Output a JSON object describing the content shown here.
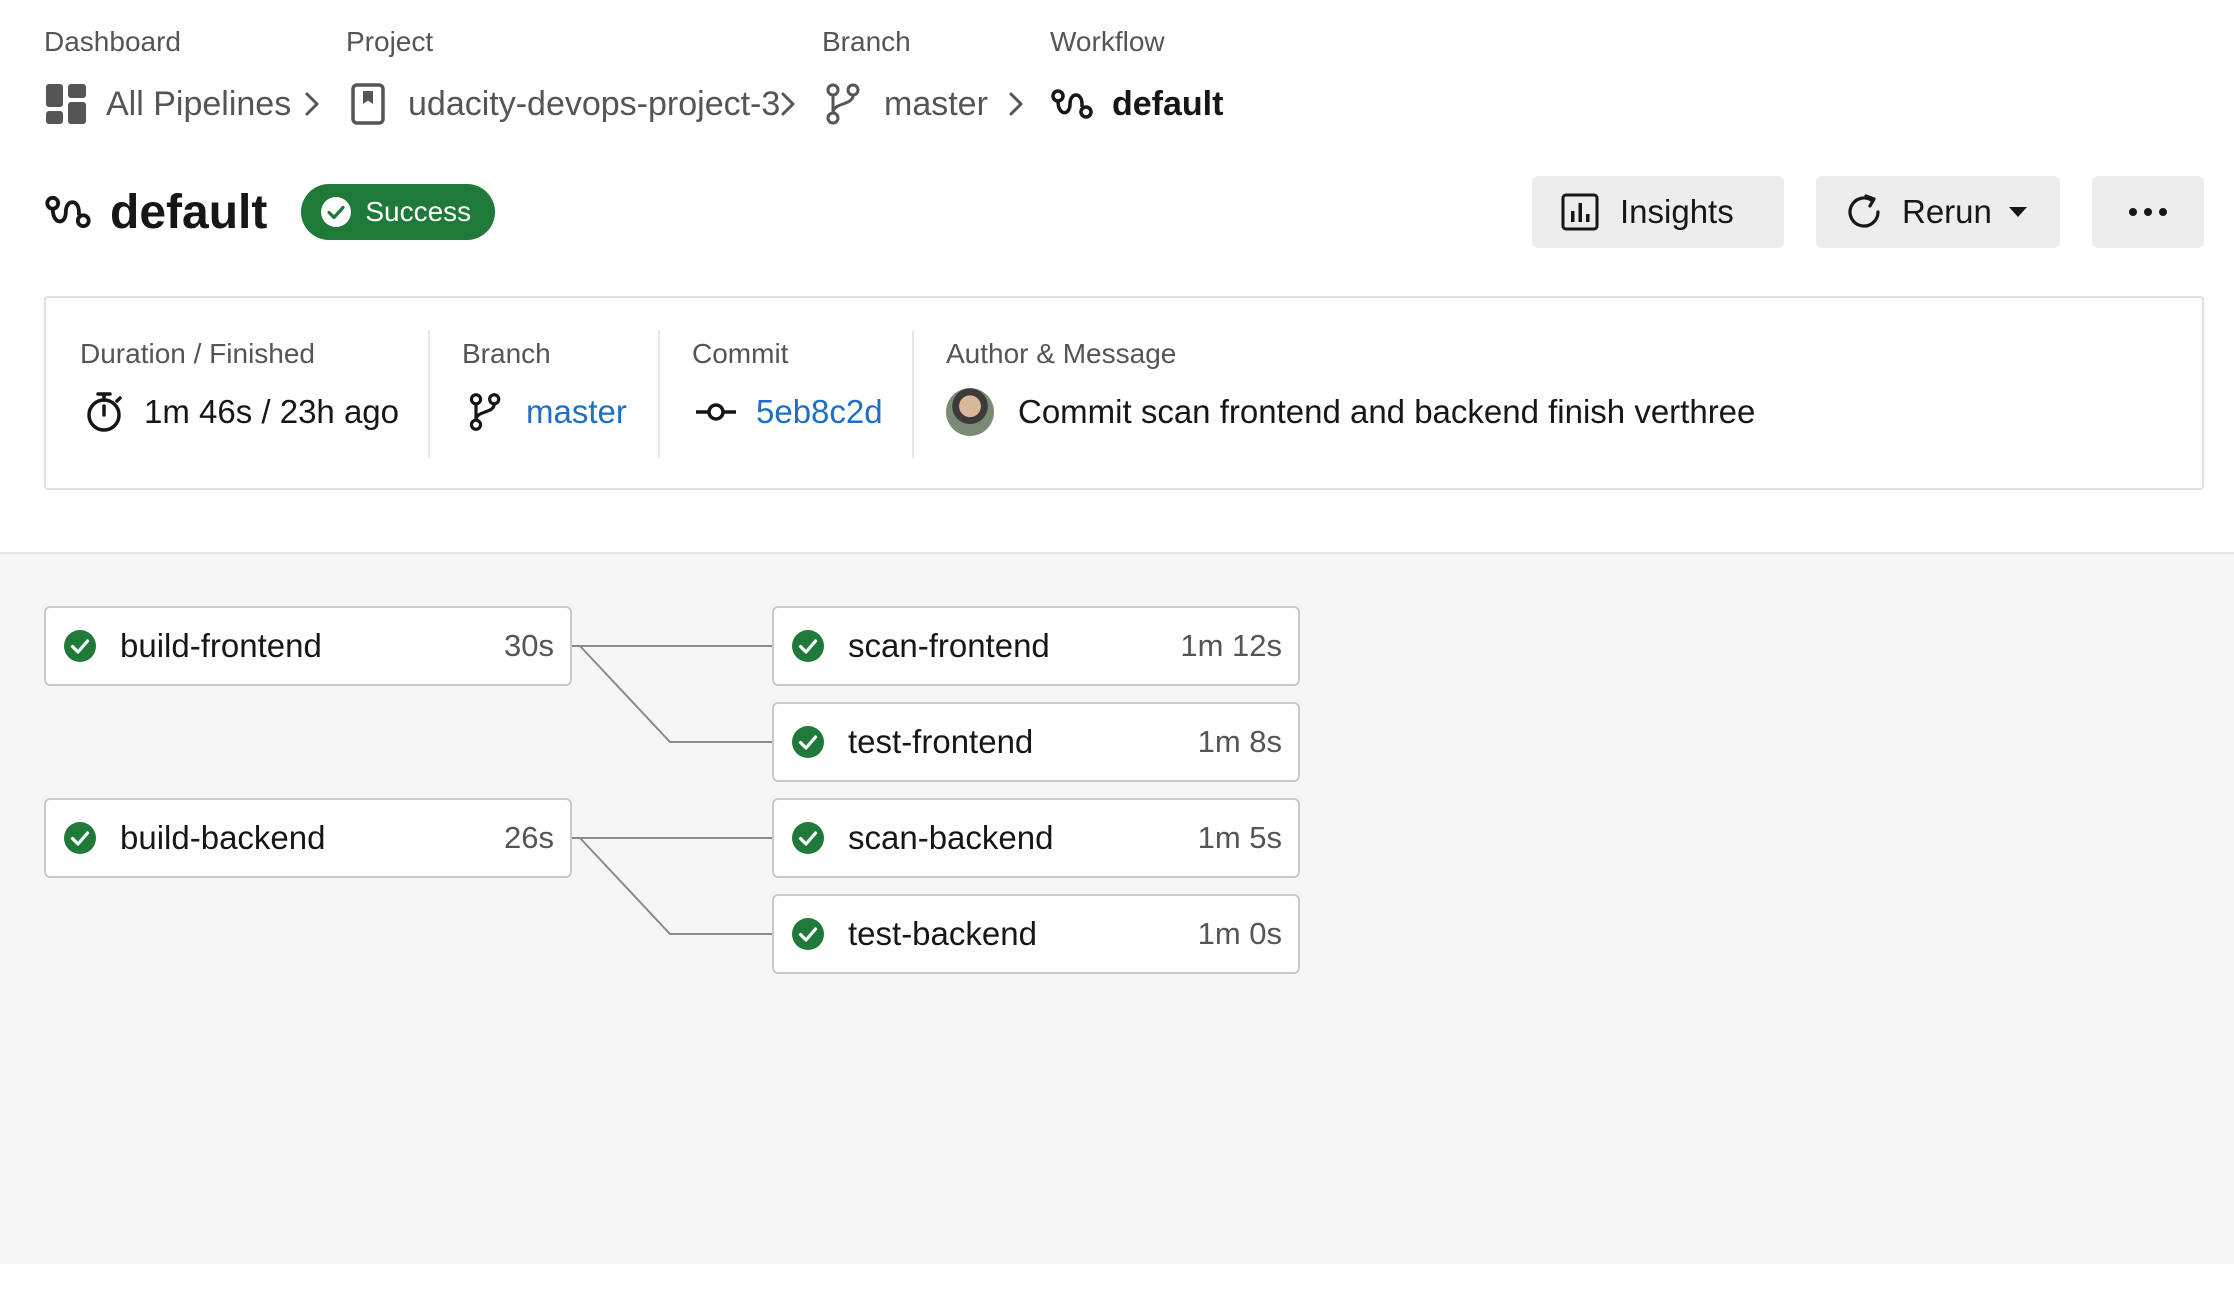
{
  "breadcrumb": [
    {
      "label": "Dashboard",
      "text": "All Pipelines",
      "icon": "dashboard-grid-icon"
    },
    {
      "label": "Project",
      "text": "udacity-devops-project-3",
      "icon": "project-bookmark-icon"
    },
    {
      "label": "Branch",
      "text": "master",
      "icon": "branch-icon"
    },
    {
      "label": "Workflow",
      "text": "default",
      "icon": "workflow-icon"
    }
  ],
  "header": {
    "title": "default",
    "status": "Success",
    "insights_label": "Insights",
    "rerun_label": "Rerun",
    "more_label": "•••"
  },
  "summary": {
    "duration": {
      "label": "Duration / Finished",
      "value": "1m 46s / 23h ago"
    },
    "branch": {
      "label": "Branch",
      "value": "master"
    },
    "commit": {
      "label": "Commit",
      "value": "5eb8c2d"
    },
    "author": {
      "label": "Author & Message",
      "value": "Commit scan frontend and backend finish verthree"
    }
  },
  "jobs": [
    {
      "name": "build-frontend",
      "duration": "30s",
      "status": "success"
    },
    {
      "name": "scan-frontend",
      "duration": "1m 12s",
      "status": "success"
    },
    {
      "name": "test-frontend",
      "duration": "1m 8s",
      "status": "success"
    },
    {
      "name": "build-backend",
      "duration": "26s",
      "status": "success"
    },
    {
      "name": "scan-backend",
      "duration": "1m 5s",
      "status": "success"
    },
    {
      "name": "test-backend",
      "duration": "1m 0s",
      "status": "success"
    }
  ],
  "colors": {
    "success": "#1f7a3a",
    "link": "#1f6fc5",
    "graph_background": "#f6f6f6"
  }
}
